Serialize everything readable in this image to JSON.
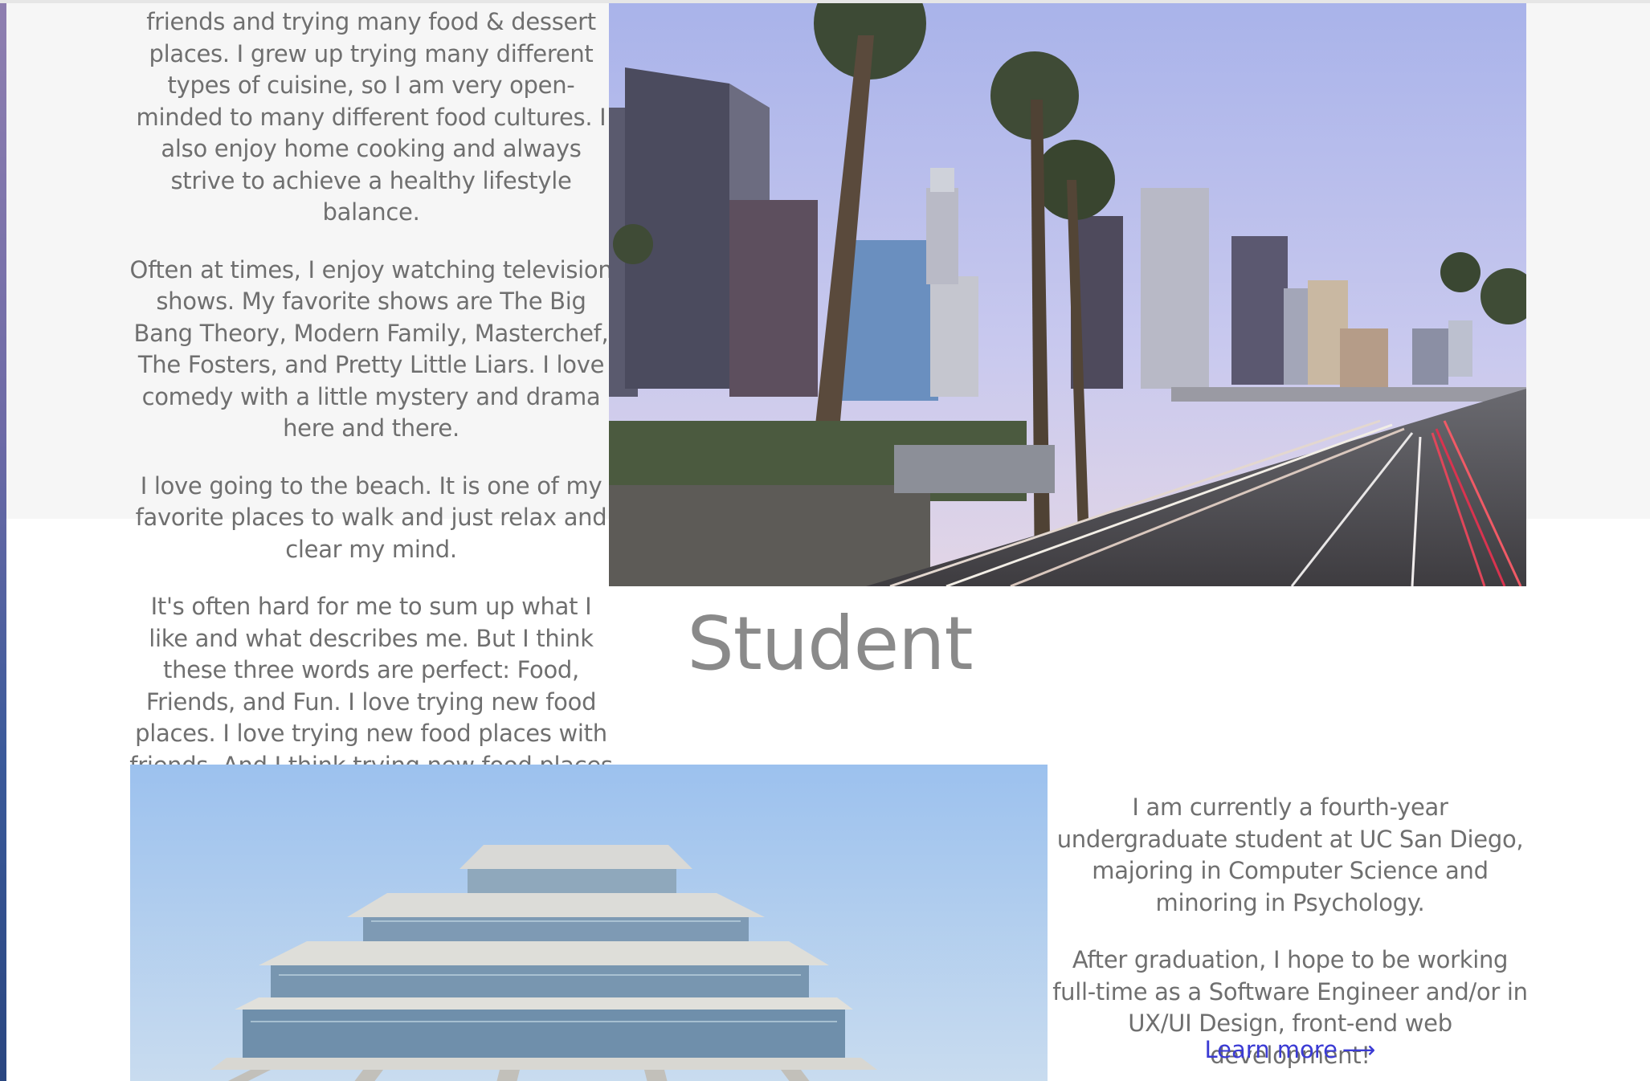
{
  "about": {
    "paragraphs": [
      "friends and trying many food & dessert places. I grew up trying many different types of cuisine, so I am very open-minded to many different food cultures. I also enjoy home cooking and always strive to achieve a healthy lifestyle balance.",
      "Often at times, I enjoy watching television shows. My favorite shows are The Big Bang Theory, Modern Family, Masterchef, The Fosters, and Pretty Little Liars. I love comedy with a little mystery and drama here and there.",
      "I love going to the beach. It is one of my favorite places to walk and just relax and clear my mind.",
      "It's often hard for me to sum up what I like and what describes me. But I think these three words are perfect: Food, Friends, and Fun. I love trying new food places. I love trying new food places with friends. And I think trying new food places with friends is fun!"
    ]
  },
  "student": {
    "title": "Student",
    "paragraphs": [
      "I am currently a fourth-year undergraduate student at UC San Diego, majoring in Computer Science and minoring in Psychology.",
      "After graduation, I hope to be working full-time as a Software Engineer and/or in UX/UI Design, front-end web development!"
    ],
    "link_label": "Learn more",
    "link_arrow": "⟶"
  },
  "colors": {
    "text": "#6f6f6f",
    "link": "#3b3bd4",
    "band": "#f6f6f6"
  }
}
